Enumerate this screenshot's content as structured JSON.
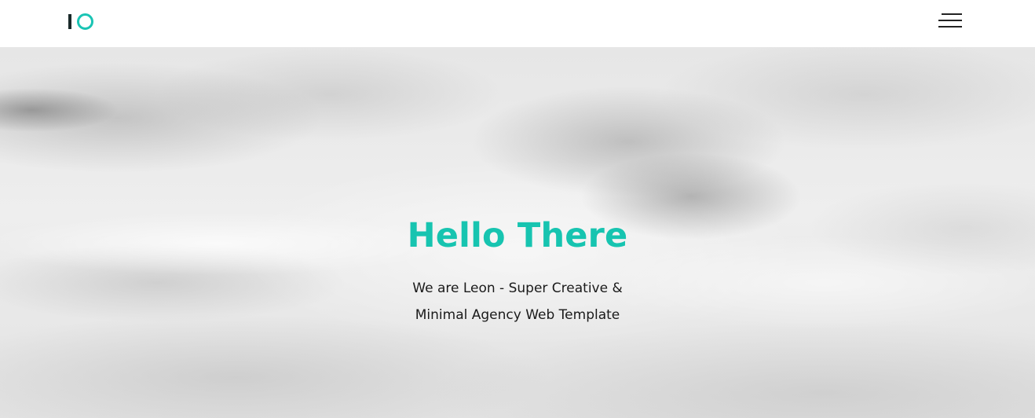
{
  "brand": {
    "logo_text": "IO",
    "accent_color": "#17c4b0",
    "dark_color": "#1a2a2a"
  },
  "navbar": {
    "menu_icon": "hamburger-menu-icon"
  },
  "hero": {
    "title": "Hello There",
    "subtitle_line1": "We are Leon - Super Creative &",
    "subtitle_line2": "Minimal Agency Web Template",
    "background": "cloudy-sky-grayscale"
  }
}
